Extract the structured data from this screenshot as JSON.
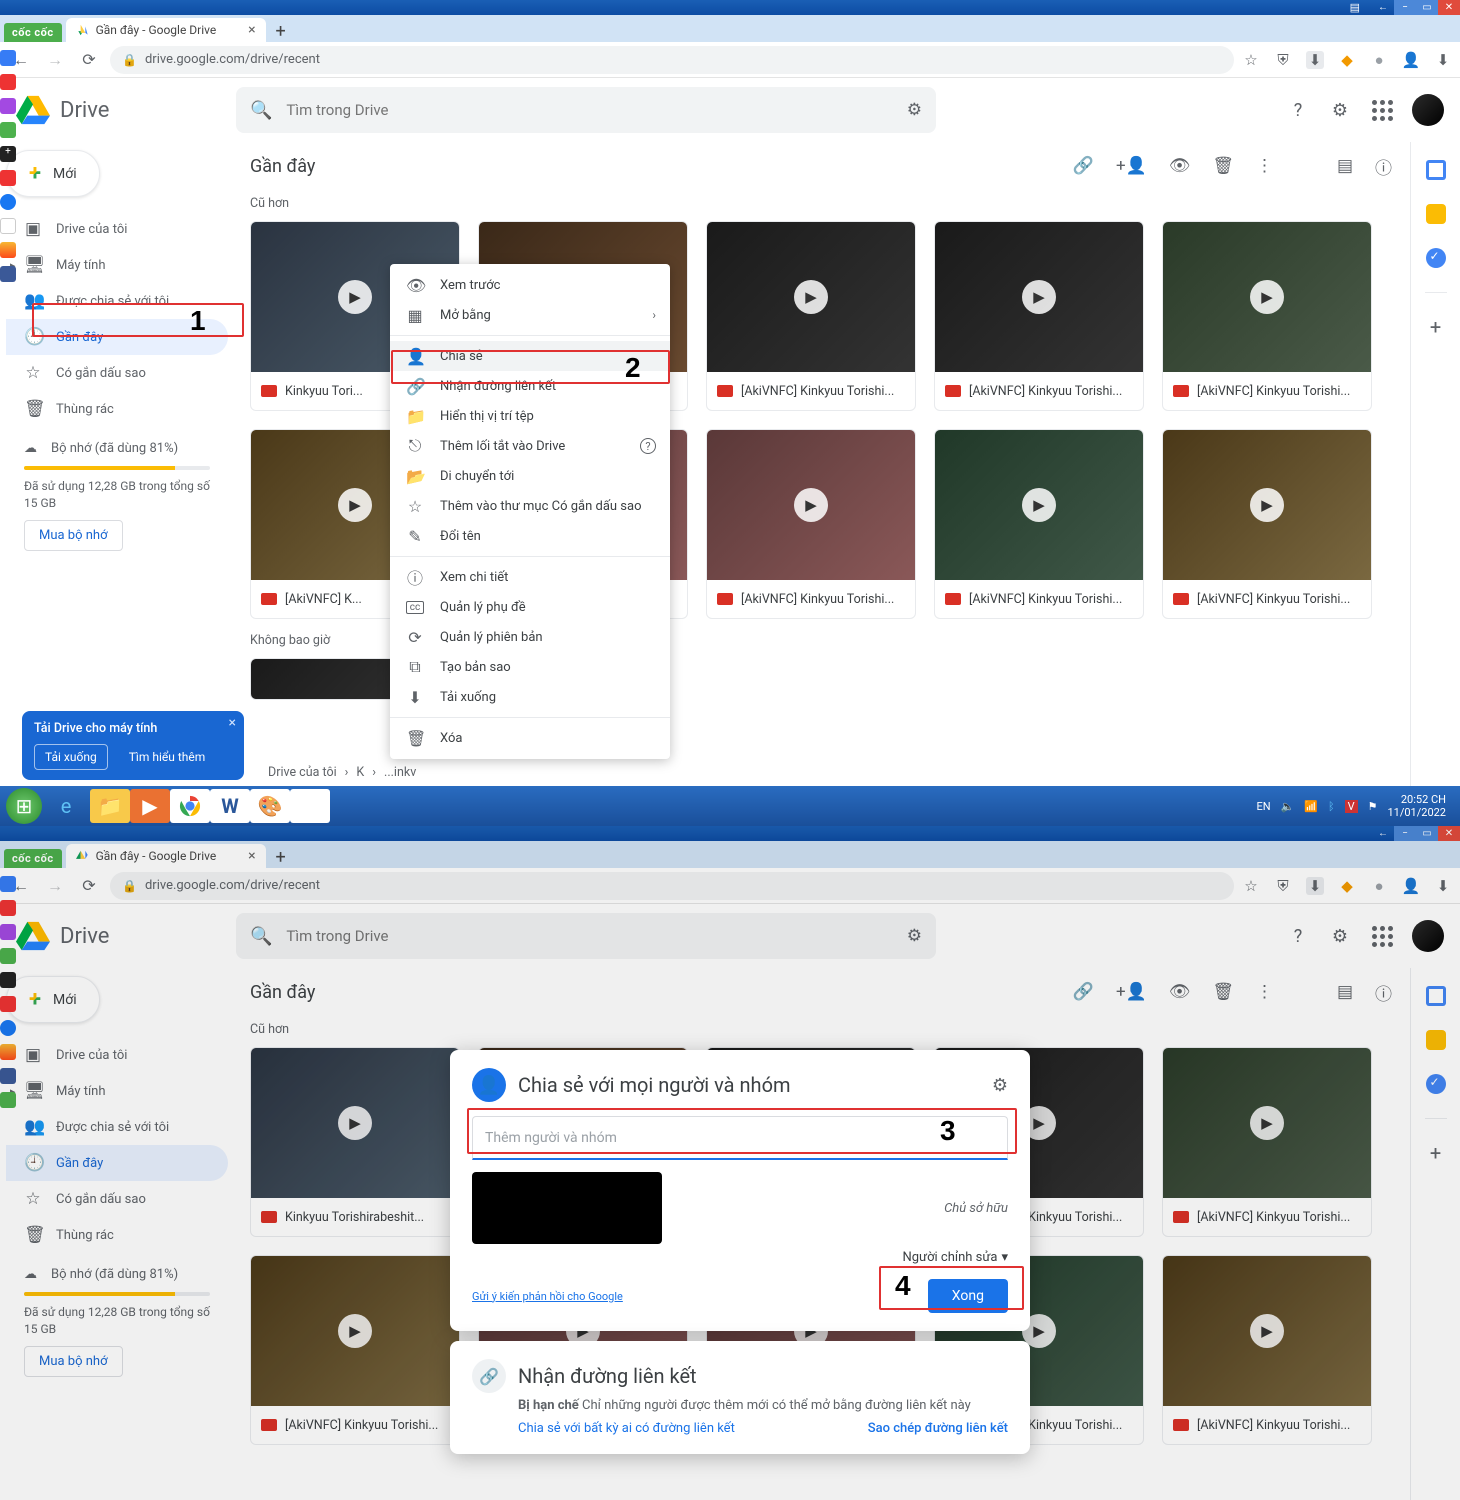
{
  "browser": {
    "product": "cốc cốc",
    "tab_title": "Gần đây - Google Drive",
    "url": "drive.google.com/drive/recent"
  },
  "drive": {
    "app_name": "Drive",
    "search_placeholder": "Tìm trong Drive",
    "new_button": "Mới",
    "nav": [
      {
        "label": "Drive của tôi",
        "icon": "drive"
      },
      {
        "label": "Máy tính",
        "icon": "computer"
      },
      {
        "label": "Được chia sẻ với tôi",
        "icon": "shared"
      },
      {
        "label": "Gần đây",
        "icon": "recent",
        "active": true
      },
      {
        "label": "Có gắn dấu sao",
        "icon": "star"
      },
      {
        "label": "Thùng rác",
        "icon": "trash"
      }
    ],
    "storage_label": "Bộ nhớ (đã dùng 81%)",
    "storage_text": "Đã sử dụng 12,28 GB trong tổng số 15 GB",
    "buy_storage": "Mua bộ nhớ",
    "page_title": "Gần đây",
    "section_older": "Cũ hơn",
    "section_never": "Không bao giờ",
    "files_row1": [
      "Kinkyuu Tori...",
      "[AkiVNFC] Kinkyuu Torishi...",
      "[AkiVNFC] Kinkyuu Torishi...",
      "[AkiVNFC] Kinkyuu Torishi...",
      "[AkiVNFC] Kinkyuu Torishi..."
    ],
    "files_row2": [
      "[AkiVNFC] K...",
      "[AkiVNFC] Kinkyuu Torishi...",
      "[AkiVNFC] Kinkyuu Torishi...",
      "[AkiVNFC] Kinkyuu Torishi...",
      "[AkiVNFC] Kinkyuu Torishi..."
    ],
    "file_long": "Kinkyuu Torishirabeshit...",
    "breadcrumb": [
      "Drive của tôi",
      "K",
      "...inkv"
    ],
    "promo": {
      "title": "Tải Drive cho máy tính",
      "download": "Tải xuống",
      "learn": "Tìm hiểu thêm"
    }
  },
  "context_menu": [
    {
      "label": "Xem trước",
      "icon": "👁"
    },
    {
      "label": "Mở bằng",
      "icon": "▦",
      "arrow": true
    },
    {
      "sep": true
    },
    {
      "label": "Chia sẻ",
      "icon": "+👤",
      "hl": true
    },
    {
      "label": "Nhận đường liên kết",
      "icon": "🔗"
    },
    {
      "label": "Hiển thị vị trí tệp",
      "icon": "📁"
    },
    {
      "label": "Thêm lối tắt vào Drive",
      "icon": "⎋",
      "help": true
    },
    {
      "label": "Di chuyển tới",
      "icon": "📂"
    },
    {
      "label": "Thêm vào thư mục Có gắn dấu sao",
      "icon": "☆"
    },
    {
      "label": "Đổi tên",
      "icon": "✎"
    },
    {
      "sep": true
    },
    {
      "label": "Xem chi tiết",
      "icon": "ⓘ"
    },
    {
      "label": "Quản lý phụ đề",
      "icon": "cc"
    },
    {
      "label": "Quản lý phiên bản",
      "icon": "⟳"
    },
    {
      "label": "Tạo bản sao",
      "icon": "⧉"
    },
    {
      "label": "Tải xuống",
      "icon": "⬇"
    },
    {
      "sep": true
    },
    {
      "label": "Xóa",
      "icon": "🗑"
    }
  ],
  "share_dialog": {
    "title": "Chia sẻ với mọi người và nhóm",
    "add_placeholder": "Thêm người và nhóm",
    "owner_role": "Chủ sở hữu",
    "editor_role": "Người chỉnh sửa",
    "feedback": "Gửi ý kiến phản hồi cho Google",
    "done": "Xong",
    "link_title": "Nhận đường liên kết",
    "link_desc_bold": "Bị hạn chế",
    "link_desc": " Chỉ những người được thêm mới có thể mở bằng đường liên kết này",
    "link_change": "Chia sẻ với bất kỳ ai có đường liên kết",
    "copy_link": "Sao chép đường liên kết"
  },
  "taskbar": {
    "lang": "EN",
    "time": "20:52 CH",
    "date": "11/01/2022"
  },
  "steps": {
    "one": "1",
    "two": "2",
    "three": "3",
    "four": "4"
  }
}
